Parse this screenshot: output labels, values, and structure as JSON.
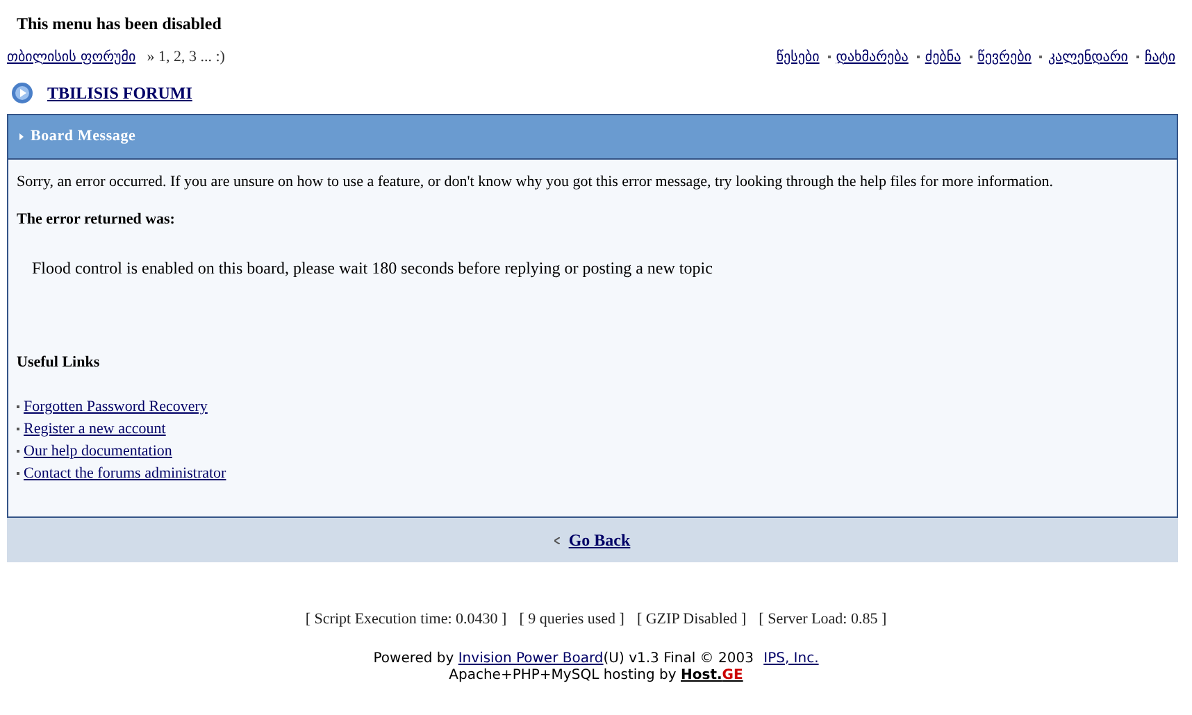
{
  "notice": "This menu has been disabled",
  "breadcrumb": {
    "link": "თბილისის ფორუმი",
    "suffix": "» 1, 2, 3 ... :)"
  },
  "nav_links": [
    "წესები",
    "დახმარება",
    "ძებნა",
    "წევრები",
    "კალენდარი",
    "ჩატი"
  ],
  "forum_title": "TBILISIS FORUMI",
  "board": {
    "header": "Board Message",
    "intro": "Sorry, an error occurred. If you are unsure on how to use a feature, or don't know why you got this error message, try looking through the help files for more information.",
    "error_heading": "The error returned was:",
    "error": "Flood control is enabled on this board, please wait 180 seconds before replying or posting a new topic",
    "links_heading": "Useful Links",
    "links": [
      "Forgotten Password Recovery",
      "Register a new account",
      "Our help documentation",
      "Contact the forums administrator"
    ],
    "back_link": "Go Back"
  },
  "stats": [
    "[ Script Execution time: 0.0430 ]",
    "[ 9 queries used ]",
    "[ GZIP Disabled ]",
    "[ Server Load: 0.85 ]"
  ],
  "footer": {
    "prefix": "Powered by ",
    "product_link": "Invision Power Board",
    "middle": "(U) v1.3 Final © 2003 ",
    "company_link": "IPS, Inc.",
    "hosting": "Apache+PHP+MySQL hosting by ",
    "host_name": "Host.",
    "host_suffix": "GE"
  }
}
